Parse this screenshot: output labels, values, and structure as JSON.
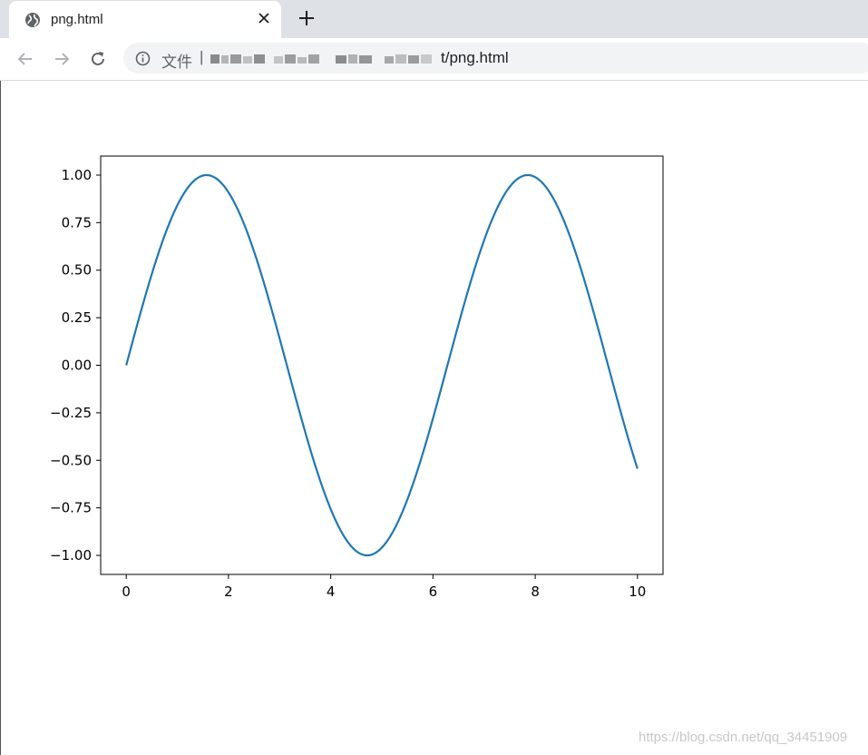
{
  "browser": {
    "tab_title": "png.html",
    "address_scheme": "文件",
    "address_separator": "|",
    "address_path_visible": "t/png.html"
  },
  "watermark": "https://blog.csdn.net/qq_34451909",
  "chart_data": {
    "type": "line",
    "function": "sin(x)",
    "x_range": [
      0,
      10
    ],
    "xlim": [
      -0.5,
      10.5
    ],
    "ylim": [
      -1.1,
      1.1
    ],
    "x_ticks": [
      0,
      2,
      4,
      6,
      8,
      10
    ],
    "y_ticks": [
      1.0,
      0.75,
      0.5,
      0.25,
      0.0,
      -0.25,
      -0.5,
      -0.75,
      -1.0
    ],
    "x_tick_labels": [
      "0",
      "2",
      "4",
      "6",
      "8",
      "10"
    ],
    "y_tick_labels": [
      "1.00",
      "0.75",
      "0.50",
      "0.25",
      "0.00",
      "−0.25",
      "−0.50",
      "−0.75",
      "−1.00"
    ],
    "line_color": "#1f77b4",
    "grid": false,
    "x": [
      0,
      0.5,
      1,
      1.5,
      2,
      2.5,
      3,
      3.5,
      4,
      4.5,
      5,
      5.5,
      6,
      6.5,
      7,
      7.5,
      8,
      8.5,
      9,
      9.5,
      10
    ],
    "y": [
      0,
      0.479,
      0.841,
      0.997,
      0.909,
      0.598,
      0.141,
      -0.351,
      -0.757,
      -0.978,
      -0.959,
      -0.706,
      -0.279,
      0.215,
      0.657,
      0.938,
      0.989,
      0.798,
      0.412,
      -0.075,
      -0.544
    ]
  }
}
